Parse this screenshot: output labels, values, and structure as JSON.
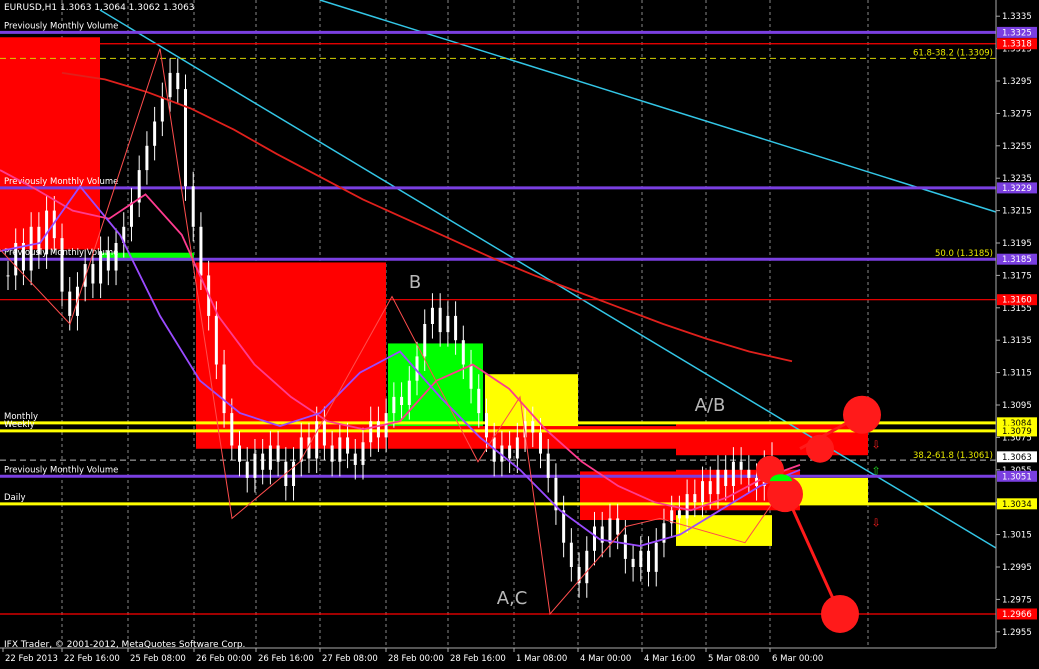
{
  "window": {
    "header": "EURUSD,H1  1.3063 1.3064 1.3062 1.3063",
    "copyright": "IFX Trader, © 2001-2012, MetaQuotes Software Corp."
  },
  "colors": {
    "background": "#000000",
    "candle": "#ffffff",
    "ma_red": "#e0201c",
    "ma_pink": "#ff3b8f",
    "ma_purple": "#9a4bff",
    "trend": "#33c6e6",
    "yellow_line": "#ffff00",
    "purple_level": "#7a3fe0",
    "red_zone": "#ff0000",
    "green_zone": "#00ff00",
    "yellow_zone": "#ffff00"
  },
  "chart_data": {
    "type": "candlestick",
    "symbol": "EURUSD",
    "timeframe": "H1",
    "ohlc_header": {
      "open": 1.3063,
      "high": 1.3064,
      "low": 1.3062,
      "close": 1.3063
    },
    "current_price": 1.3063,
    "ylim": [
      1.2945,
      1.3345
    ],
    "y_ticks": [
      1.3335,
      1.3315,
      1.3295,
      1.3275,
      1.3255,
      1.3235,
      1.3215,
      1.3195,
      1.3175,
      1.3155,
      1.3135,
      1.3115,
      1.3095,
      1.3075,
      1.3055,
      1.3035,
      1.3015,
      1.2995,
      1.2975,
      1.2955
    ],
    "y_tick_labels": [
      "1.3335",
      "1.3315",
      "1.3295",
      "1.3275",
      "1.3255",
      "1.3235",
      "1.3215",
      "1.3195",
      "1.3175",
      "1.3155",
      "1.3135",
      "1.3115",
      "1.3095",
      "1.3075",
      "1.3055",
      "1.3035",
      "1.3015",
      "1.2995",
      "1.2975",
      "1.2955"
    ],
    "x_labels": [
      "22 Feb 2013",
      "22 Feb 16:00",
      "25 Feb 08:00",
      "26 Feb 00:00",
      "26 Feb 16:00",
      "27 Feb 08:00",
      "28 Feb 00:00",
      "28 Feb 16:00",
      "1 Mar 08:00",
      "4 Mar 00:00",
      "4 Mar 16:00",
      "5 Mar 08:00",
      "6 Mar 00:00"
    ],
    "grid": "vertical dashed at date labels",
    "closes": [
      1.3175,
      1.3195,
      1.3178,
      1.3205,
      1.3188,
      1.3215,
      1.3198,
      1.3165,
      1.315,
      1.3168,
      1.3182,
      1.317,
      1.319,
      1.3178,
      1.3195,
      1.3205,
      1.322,
      1.324,
      1.3255,
      1.327,
      1.3285,
      1.33,
      1.329,
      1.323,
      1.3205,
      1.3175,
      1.315,
      1.312,
      1.309,
      1.307,
      1.306,
      1.305,
      1.3065,
      1.3055,
      1.307,
      1.306,
      1.3045,
      1.306,
      1.3075,
      1.3062,
      1.3085,
      1.307,
      1.306,
      1.3075,
      1.3065,
      1.3058,
      1.3072,
      1.3085,
      1.3075,
      1.309,
      1.31,
      1.3095,
      1.311,
      1.3125,
      1.3145,
      1.3155,
      1.314,
      1.315,
      1.3135,
      1.312,
      1.3105,
      1.309,
      1.3075,
      1.306,
      1.307,
      1.3062,
      1.3075,
      1.3085,
      1.3078,
      1.3065,
      1.305,
      1.303,
      1.301,
      1.2995,
      1.2985,
      1.3005,
      1.302,
      1.301,
      1.3025,
      1.3015,
      1.3,
      1.2995,
      1.3005,
      1.2992,
      1.301,
      1.3022,
      1.303,
      1.3025,
      1.304,
      1.3035,
      1.3048,
      1.304,
      1.3055,
      1.3045,
      1.306,
      1.3055,
      1.305,
      1.3045,
      1.3058,
      1.3063
    ],
    "moving_averages": [
      {
        "color": "red",
        "values": [
          1.33,
          1.3296,
          1.3288,
          1.3278,
          1.3265,
          1.325,
          1.3236,
          1.3222,
          1.321,
          1.3198,
          1.3186,
          1.3175,
          1.3165,
          1.3155,
          1.3145,
          1.3136,
          1.3128,
          1.3122
        ]
      },
      {
        "color": "pink",
        "values": [
          1.324,
          1.3228,
          1.3215,
          1.321,
          1.3225,
          1.32,
          1.315,
          1.312,
          1.31,
          1.3085,
          1.308,
          1.3085,
          1.311,
          1.312,
          1.3105,
          1.308,
          1.306,
          1.3045,
          1.3035,
          1.303,
          1.3038,
          1.305,
          1.3058
        ]
      },
      {
        "color": "purple",
        "values": [
          1.319,
          1.3195,
          1.323,
          1.32,
          1.315,
          1.311,
          1.309,
          1.3082,
          1.309,
          1.3115,
          1.3128,
          1.31,
          1.3075,
          1.3055,
          1.303,
          1.3012,
          1.3008,
          1.3015,
          1.303,
          1.3045,
          1.3055
        ]
      }
    ],
    "horizontal_levels": [
      {
        "price": 1.3325,
        "color": "purple",
        "label": "Previously Monthly Volume",
        "tag": "1.3325"
      },
      {
        "price": 1.3318,
        "color": "red",
        "label": "",
        "tag": "1.3318"
      },
      {
        "price": 1.3229,
        "color": "purple",
        "label": "Previously Monthly Volume",
        "tag": "1.3229"
      },
      {
        "price": 1.3185,
        "color": "purple",
        "label": "Previously Monthly Volume",
        "tag": "1.3185"
      },
      {
        "price": 1.316,
        "color": "red",
        "label": "",
        "tag": "1.3160"
      },
      {
        "price": 1.3084,
        "color": "yellow",
        "label": "Monthly",
        "tag": "1.3084"
      },
      {
        "price": 1.3079,
        "color": "yellow",
        "label": "Weekly",
        "tag": "1.3079"
      },
      {
        "price": 1.3051,
        "color": "purple",
        "label": "Previously Monthly Volume",
        "tag": "1.3051"
      },
      {
        "price": 1.3034,
        "color": "yellow",
        "label": "Daily",
        "tag": "1.3034"
      },
      {
        "price": 1.2966,
        "color": "red",
        "label": "",
        "tag": "1.2966"
      }
    ],
    "fibonacci_levels": [
      {
        "price": 1.3309,
        "label": "61.8-38.2 (1.3309)"
      },
      {
        "price": 1.3185,
        "label": "50.0 (1.3185)"
      },
      {
        "price": 1.3061,
        "label": "38.2-61.8 (1.3061)"
      }
    ],
    "wave_labels": [
      "B",
      "A/B",
      "A,C"
    ],
    "price_tag": "1.3063"
  }
}
